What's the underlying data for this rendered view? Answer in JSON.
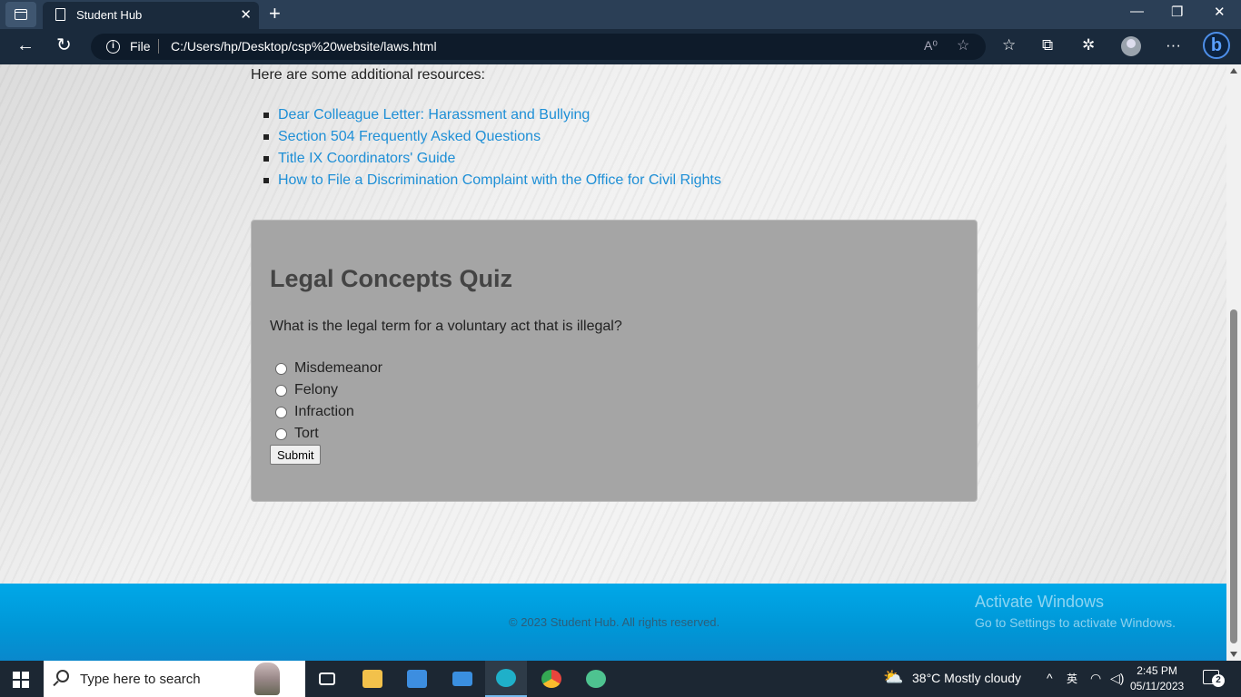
{
  "browser": {
    "tab_title": "Student Hub",
    "tab_close": "✕",
    "new_tab": "+",
    "minimize": "—",
    "maximize": "❐",
    "close": "✕",
    "back": "←",
    "refresh": "↻",
    "info": "i",
    "protocol_label": "File",
    "url": "C:/Users/hp/Desktop/csp%20website/laws.html",
    "read_aloud": "A⁰",
    "favorite_add": "☆",
    "favorites": "☆",
    "collections": "⧉",
    "extensions": "✲",
    "more": "···",
    "bing": "b"
  },
  "page": {
    "intro": "Here are some additional resources:",
    "links": [
      "Dear Colleague Letter: Harassment and Bullying",
      "Section 504 Frequently Asked Questions",
      "Title IX Coordinators' Guide",
      "How to File a Discrimination Complaint with the Office for Civil Rights"
    ],
    "quiz": {
      "title": "Legal Concepts Quiz",
      "question": "What is the legal term for a voluntary act that is illegal?",
      "options": [
        "Misdemeanor",
        "Felony",
        "Infraction",
        "Tort"
      ],
      "submit_label": "Submit"
    },
    "footer": "© 2023 Student Hub. All rights reserved."
  },
  "watermark": {
    "line1": "Activate Windows",
    "line2": "Go to Settings to activate Windows."
  },
  "taskbar": {
    "search_placeholder": "Type here to search",
    "weather": "38°C  Mostly cloudy",
    "time": "2:45 PM",
    "date": "05/11/2023",
    "notifications_count": "2",
    "apps": [
      {
        "name": "task-view",
        "color": "#ffffff"
      },
      {
        "name": "file-explorer",
        "color": "#f2c14b"
      },
      {
        "name": "microsoft-store",
        "color": "#3d8ee0"
      },
      {
        "name": "mail",
        "color": "#3a8fe0"
      },
      {
        "name": "edge",
        "color": "#1fb0c9"
      },
      {
        "name": "chrome",
        "color": "#e8453c"
      },
      {
        "name": "atom",
        "color": "#4ec390"
      }
    ]
  }
}
